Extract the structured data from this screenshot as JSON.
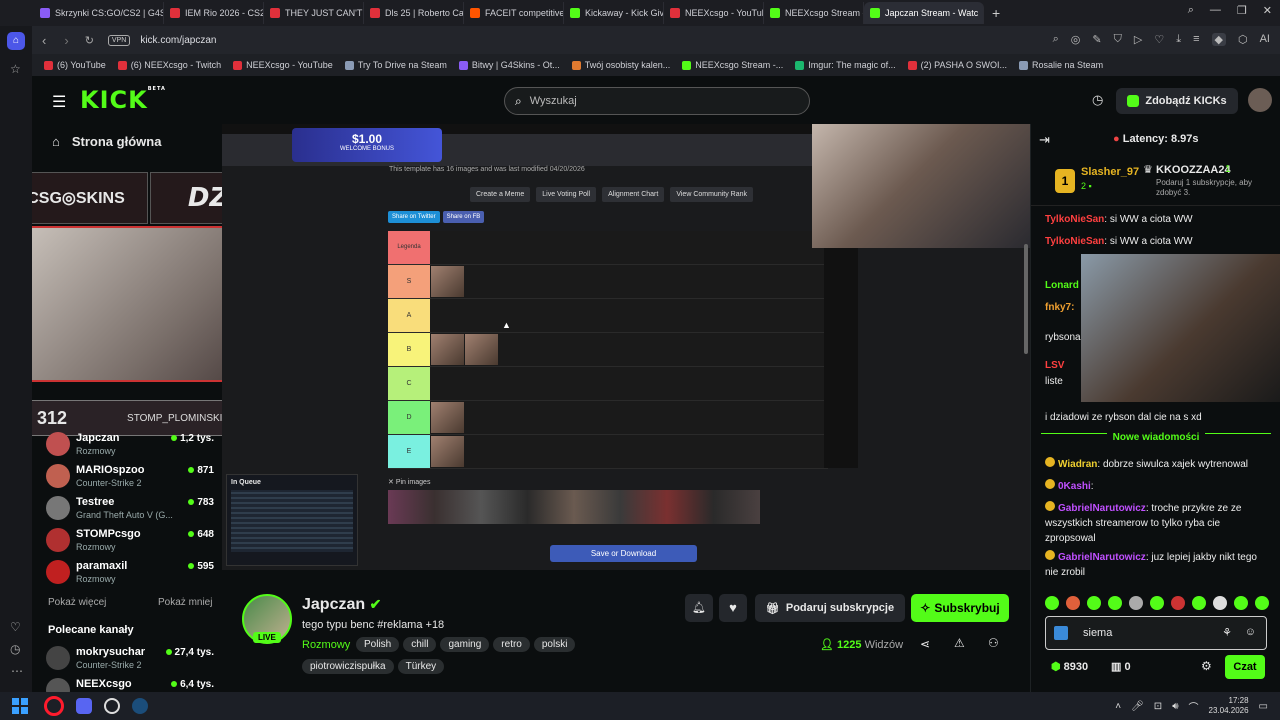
{
  "browser": {
    "tabs": [
      {
        "label": "Skrzynki CS:GO/CS2 | G4S",
        "color": "#8a5cf5"
      },
      {
        "label": "IEM Rio 2026 - CS2 Fragn",
        "color": "#e0303b"
      },
      {
        "label": "THEY JUST CAN'T LOSE |",
        "color": "#e0303b"
      },
      {
        "label": "Dls 25 | Roberto Carlos Ch",
        "color": "#e0303b"
      },
      {
        "label": "FACEIT competitive match",
        "color": "#ff5500"
      },
      {
        "label": "Kickaway - Kick Giveaway",
        "color": "#53fc18"
      },
      {
        "label": "NEEXcsgo - YouTube",
        "color": "#e0303b"
      },
      {
        "label": "NEEXcsgo Stream - Watc",
        "color": "#53fc18"
      },
      {
        "label": "Japczan Stream - Watc",
        "color": "#53fc18",
        "active": true
      }
    ],
    "url": "kick.com/japczan",
    "vpn": "VPN",
    "ai_label": "AI",
    "bookmarks": [
      {
        "label": "(6) YouTube",
        "color": "#e0303b"
      },
      {
        "label": "(6) NEEXcsgo - Twitch",
        "color": "#e0303b"
      },
      {
        "label": "NEEXcsgo - YouTube",
        "color": "#e0303b"
      },
      {
        "label": "Try To Drive na Steam",
        "color": "#8a9bb5"
      },
      {
        "label": "Bitwy | G4Skins - Ot...",
        "color": "#8a5cf5"
      },
      {
        "label": "Twój osobisty kalen...",
        "color": "#e07a30"
      },
      {
        "label": "NEEXcsgo Stream -...",
        "color": "#53fc18"
      },
      {
        "label": "Imgur: The magic of...",
        "color": "#1bb76e"
      },
      {
        "label": "(2) PASHA O SWOI...",
        "color": "#e0303b"
      },
      {
        "label": "Rosalie na Steam",
        "color": "#8a9bb5"
      }
    ]
  },
  "header": {
    "logo": "KICK",
    "beta": "BETA",
    "search_placeholder": "Wyszukaj",
    "kicks_button": "Zdobądź KICKs"
  },
  "sidebar": {
    "home": "Strona główna",
    "channels": [
      {
        "name": "Japczan",
        "category": "Rozmowy",
        "viewers": "1,2 tys.",
        "color": "#c05050"
      },
      {
        "name": "MARIOspzoo",
        "category": "Counter-Strike 2",
        "viewers": "871",
        "color": "#c06050"
      },
      {
        "name": "Testree",
        "category": "Grand Theft Auto V (G...",
        "viewers": "783",
        "color": "#777"
      },
      {
        "name": "STOMPcsgo",
        "category": "Rozmowy",
        "viewers": "648",
        "color": "#b03030"
      },
      {
        "name": "paramaxil",
        "category": "Rozmowy",
        "viewers": "595",
        "color": "#c02020"
      }
    ],
    "show_more": "Pokaż więcej",
    "show_less": "Pokaż mniej",
    "recommended_title": "Polecane kanały",
    "recommended": [
      {
        "name": "mokrysuchar",
        "category": "Counter-Strike 2",
        "viewers": "27,4 tys.",
        "color": "#444"
      },
      {
        "name": "NEEXcsgo",
        "category": "",
        "viewers": "6,4 tys.",
        "color": "#555"
      }
    ]
  },
  "stream": {
    "overlay_csgo": "CSG◎SKINS",
    "overlay_dzik": "DZIK",
    "counter": "312",
    "social": "STOMP_PLOMINSKI • ♪ STO",
    "banner_amount": "$1.00",
    "banner_text": "WELCOME BONUS",
    "tier_info": "This template has 16 images and was last modified 04/20/2026",
    "tier_buttons": [
      "Create a Meme",
      "Live Voting Poll",
      "Alignment Chart",
      "View Community Rank"
    ],
    "share_buttons": [
      "Share on Twitter",
      "Share on FB"
    ],
    "tiers": [
      {
        "label": "Legenda",
        "color": "#f07070"
      },
      {
        "label": "S",
        "color": "#f4a07a"
      },
      {
        "label": "A",
        "color": "#f9dd7b"
      },
      {
        "label": "B",
        "color": "#f8f37a"
      },
      {
        "label": "C",
        "color": "#b6f07a"
      },
      {
        "label": "D",
        "color": "#7af07a"
      },
      {
        "label": "E",
        "color": "#7af0e0"
      }
    ],
    "pin_label": "Pin images",
    "save_button": "Save or Download",
    "queue_label": "In Queue"
  },
  "channel": {
    "name": "Japczan",
    "live_badge": "LIVE",
    "title": "tego typu benc  #reklama +18",
    "category": "Rozmowy",
    "tags": [
      "Polish",
      "chill",
      "gaming",
      "retro",
      "polski",
      "piotrowiczispułka",
      "Türkey"
    ],
    "viewers": "1225",
    "viewers_label": "Widzów",
    "gift_button": "Podaruj subskrypcje",
    "subscribe_button": "Subskrybuj"
  },
  "chat": {
    "latency": "Latency: 8.97s",
    "leader1_rank": "1",
    "leader1_name": "Slasher_97",
    "leader1_count": "2",
    "leader2_name": "KKOOZZAA24",
    "leader2_count": "1",
    "leader2_note": "Podaruj 1 subskrypcje, aby zdobyć 3.",
    "messages": [
      {
        "user": "TylkoNieSan",
        "text": "si WW a ciota WW",
        "color": "#ff4040"
      },
      {
        "user": "TylkoNieSan",
        "text": "si WW a ciota WW",
        "color": "#ff4040"
      },
      {
        "user": "Lonard",
        "text": "",
        "color": "#53fc18"
      },
      {
        "user": "fnky7:",
        "text": "",
        "color": "#f0a030"
      },
      {
        "user": "",
        "text": "rybsona",
        "color": "#fff"
      },
      {
        "user": "LSV",
        "text": "",
        "color": "#ff4040"
      },
      {
        "user": "",
        "text": "liste",
        "color": "#fff"
      },
      {
        "user": "",
        "text": "i dziadowi ze rybson dal cie na s xd",
        "color": "#fff"
      }
    ],
    "new_messages": "Nowe wiadomości",
    "new_msgs": [
      {
        "user": "Wiadran",
        "text": "dobrze siwulca xajek wytrenowal",
        "color": "#f0d030"
      },
      {
        "user": "0Kashi",
        "text": "",
        "color": "#c050ff"
      },
      {
        "user": "GabrielNarutowicz",
        "text": "troche przykre ze ze wszystkich streamerow to tylko ryba cie zpropsowal",
        "color": "#c050ff"
      },
      {
        "user": "GabrielNarutowicz",
        "text": "juz lepiej jakby nikt tego nie zrobil",
        "color": "#c050ff"
      }
    ],
    "input_value": "siema",
    "kicks_count": "8930",
    "subs_count": "0",
    "send_button": "Czat"
  },
  "taskbar": {
    "time": "17:28",
    "date": "23.04.2026"
  }
}
